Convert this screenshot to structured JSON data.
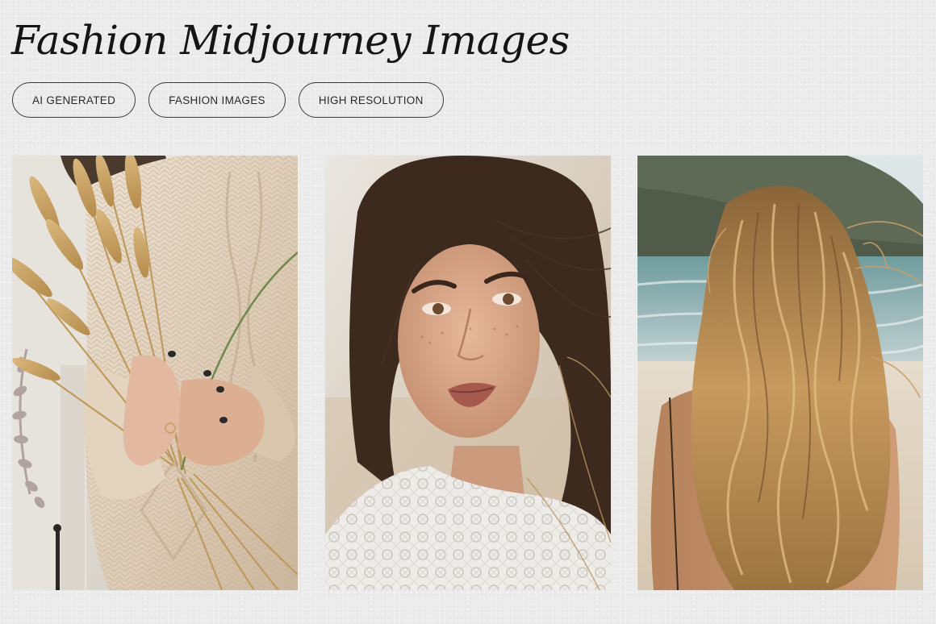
{
  "header": {
    "title": "Fashion Midjourney Images"
  },
  "tags": [
    {
      "label": "AI GENERATED"
    },
    {
      "label": "FASHION IMAGES"
    },
    {
      "label": "HIGH RESOLUTION"
    }
  ],
  "gallery": {
    "images": [
      {
        "subject": "woman-in-knit-sweater-holding-wheat-bouquet"
      },
      {
        "subject": "woman-portrait-with-windswept-hair-and-lace-top"
      },
      {
        "subject": "woman-with-long-wavy-hair-on-beach"
      }
    ]
  },
  "colors": {
    "background": "#ececec",
    "text": "#151515",
    "tag_border": "#3a3a3a"
  }
}
